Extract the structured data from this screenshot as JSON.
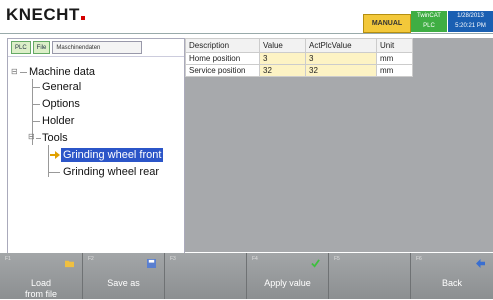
{
  "header": {
    "logo_text": "KNECHT",
    "mode": "MANUAL",
    "runtime_top": "TwinCAT",
    "runtime_bottom": "PLC",
    "date": "1/28/2013",
    "time": "5:20:21 PM"
  },
  "left_panel": {
    "tags": [
      "PLC",
      "File"
    ],
    "path": "Maschinendaten",
    "tree": {
      "root": "Machine data",
      "items": [
        "General",
        "Options",
        "Holder",
        "Tools"
      ],
      "tools_children": [
        "Grinding wheel front",
        "Grinding wheel rear"
      ],
      "selected": "Grinding wheel front"
    }
  },
  "table": {
    "headers": [
      "Description",
      "Value",
      "ActPlcValue",
      "Unit"
    ],
    "rows": [
      {
        "description": "Home position",
        "value": "3",
        "act": "3",
        "unit": "mm"
      },
      {
        "description": "Service position",
        "value": "32",
        "act": "32",
        "unit": "mm"
      }
    ]
  },
  "function_keys": [
    {
      "key": "F1",
      "label": "Load from file",
      "icon": "folder-icon"
    },
    {
      "key": "F2",
      "label": "Save as",
      "icon": "disk-icon"
    },
    {
      "key": "F3",
      "label": "",
      "icon": ""
    },
    {
      "key": "F4",
      "label": "Apply value",
      "icon": "checkmark-icon"
    },
    {
      "key": "F5",
      "label": "",
      "icon": ""
    },
    {
      "key": "F6",
      "label": "Back",
      "icon": "back-arrow-icon"
    }
  ],
  "colors": {
    "mode_bg": "#f3c83a",
    "runtime_bg": "#3fae43",
    "datetime_bg": "#1a5fb2",
    "selection": "#2b55c8",
    "value_cell": "#fdf3c4"
  }
}
